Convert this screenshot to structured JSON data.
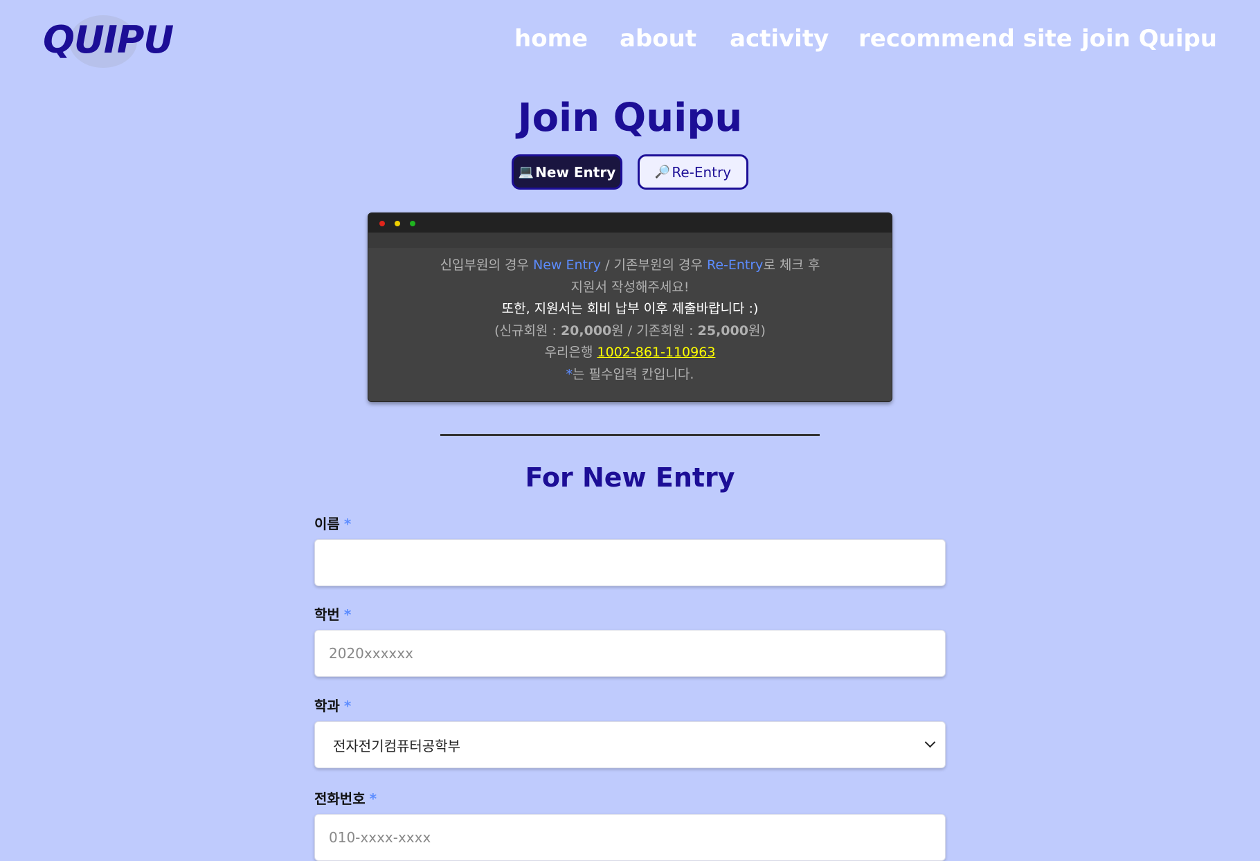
{
  "header": {
    "logo": "QUIPU",
    "nav": [
      "home",
      "about",
      "activity",
      "recommend site",
      "join Quipu"
    ]
  },
  "page_title": "Join Quipu",
  "toggle": {
    "new_entry_icon": "💻",
    "new_entry_label": "New Entry",
    "re_entry_icon": "🔎",
    "re_entry_label": "Re-Entry"
  },
  "notice": {
    "line1_a": "신입부원의 경우 ",
    "line1_b": "New Entry",
    "line1_c": " / 기존부원의 경우 ",
    "line1_d": "Re-Entry",
    "line1_e": "로 체크 후",
    "line2": "지원서 작성해주세요!",
    "line3": "또한, 지원서는 회비 납부 이후 제출바랍니다 :)",
    "line4_a": "(신규회원 : ",
    "line4_b": "20,000",
    "line4_c": "원 / 기존회원 : ",
    "line4_d": "25,000",
    "line4_e": "원)",
    "line5_a": "우리은행 ",
    "line5_b": "1002-861-110963",
    "line6_a": "*",
    "line6_b": "는 필수입력 칸입니다."
  },
  "section_title": "For New Entry",
  "form": {
    "name_label": "이름",
    "student_id_label": "학번",
    "student_id_placeholder": "2020xxxxxx",
    "dept_label": "학과",
    "dept_value": "전자전기컴퓨터공학부",
    "phone_label": "전화번호",
    "phone_placeholder": "010-xxxx-xxxx",
    "required_mark": "*"
  },
  "colors": {
    "background": "#bfcbfd",
    "brand": "#1c0e96",
    "accent_blue": "#5c8cff",
    "account_yellow": "#ffff00"
  }
}
